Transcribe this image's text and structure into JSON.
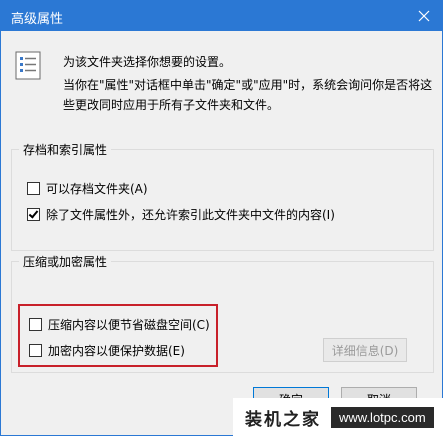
{
  "window": {
    "title": "高级属性"
  },
  "description": {
    "line1": "为该文件夹选择你想要的设置。",
    "line2": "当你在\"属性\"对话框中单击\"确定\"或\"应用\"时，系统会询问你是否将这些更改同时应用于所有子文件夹和文件。"
  },
  "archive_group": {
    "title": "存档和索引属性",
    "options": [
      {
        "label": "可以存档文件夹(A)",
        "checked": false
      },
      {
        "label": "除了文件属性外，还允许索引此文件夹中文件的内容(I)",
        "checked": true
      }
    ]
  },
  "compress_group": {
    "title": "压缩或加密属性",
    "options": [
      {
        "label": "压缩内容以便节省磁盘空间(C)",
        "checked": false
      },
      {
        "label": "加密内容以便保护数据(E)",
        "checked": false
      }
    ],
    "details_button": "详细信息(D)"
  },
  "buttons": {
    "ok": "确定",
    "cancel": "取消"
  },
  "watermark": {
    "text": "装机之家",
    "site": "www.lotpc.com"
  },
  "colors": {
    "titlebar": "#2b78d4",
    "highlight": "#c8202a"
  }
}
